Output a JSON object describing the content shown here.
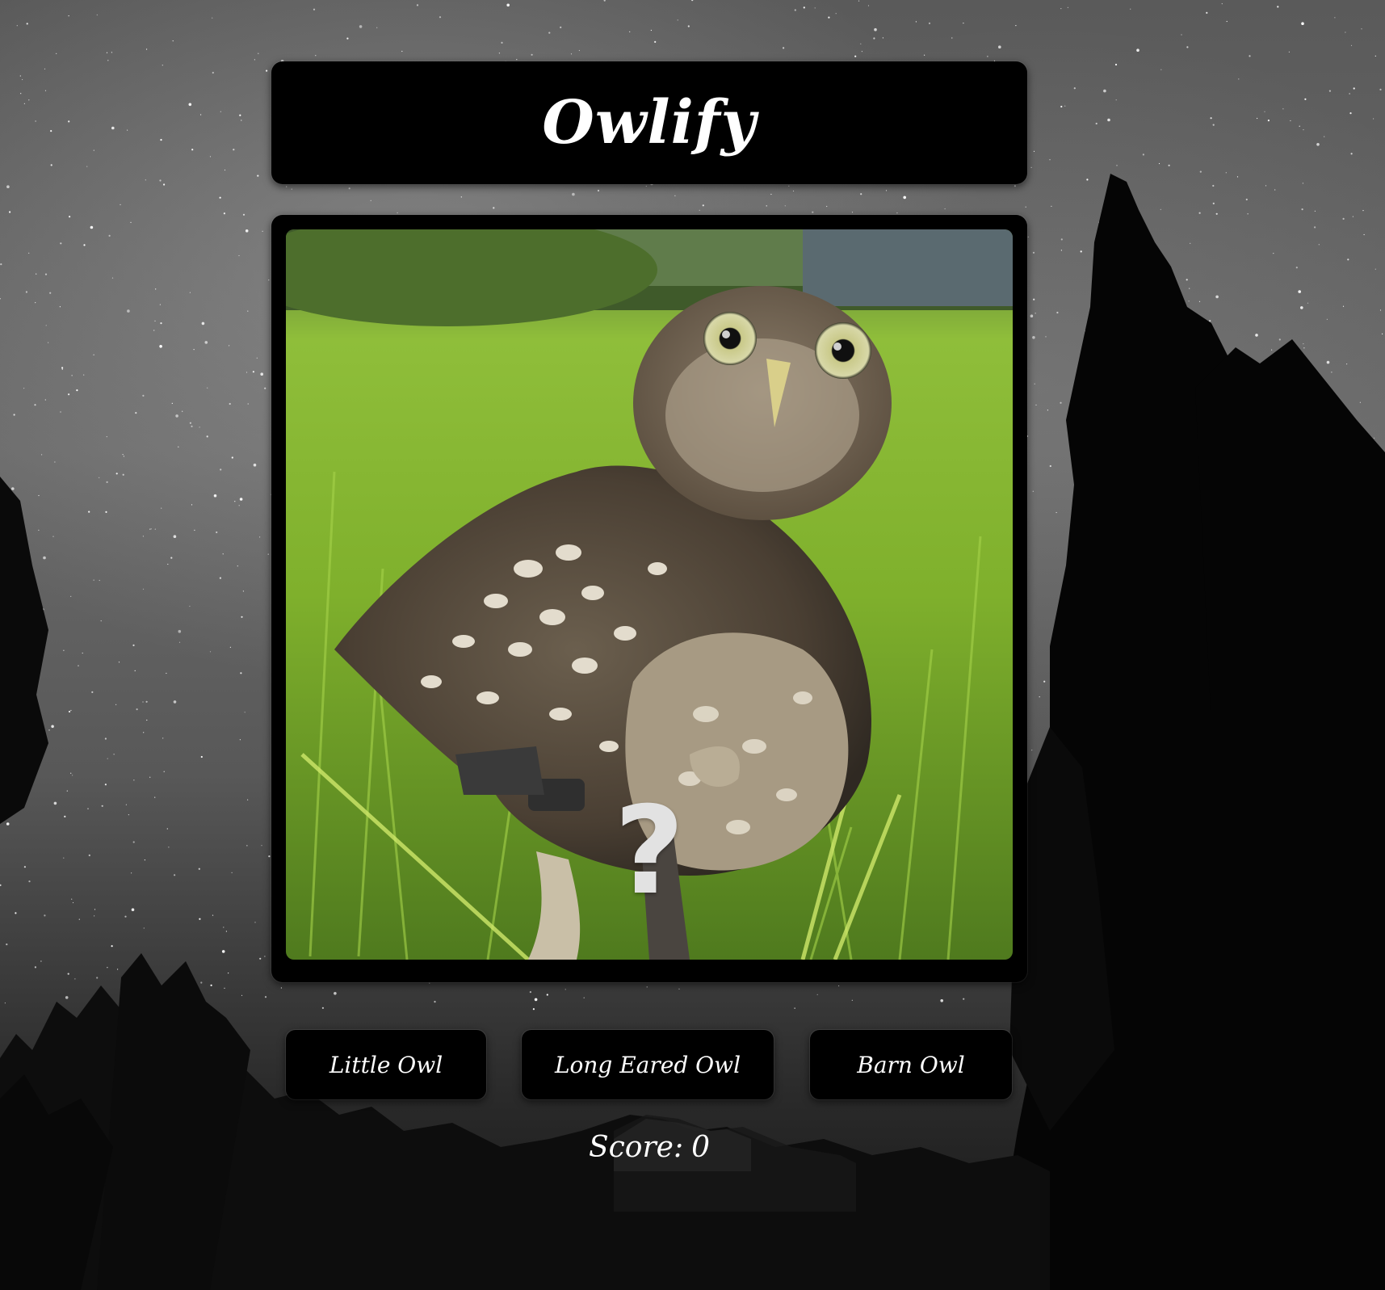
{
  "app": {
    "title": "Owlify"
  },
  "quiz": {
    "mystery_mark": "?",
    "answers": [
      {
        "label": "Little Owl"
      },
      {
        "label": "Long Eared Owl"
      },
      {
        "label": "Barn Owl"
      }
    ],
    "score_label": "Score:",
    "score_value": "0"
  },
  "icons": {
    "background": "starry-night-forest-background",
    "photo": "owl-photo"
  },
  "colors": {
    "panel": "#000000",
    "text": "#ffffff",
    "mark": "#e2e2e2"
  }
}
